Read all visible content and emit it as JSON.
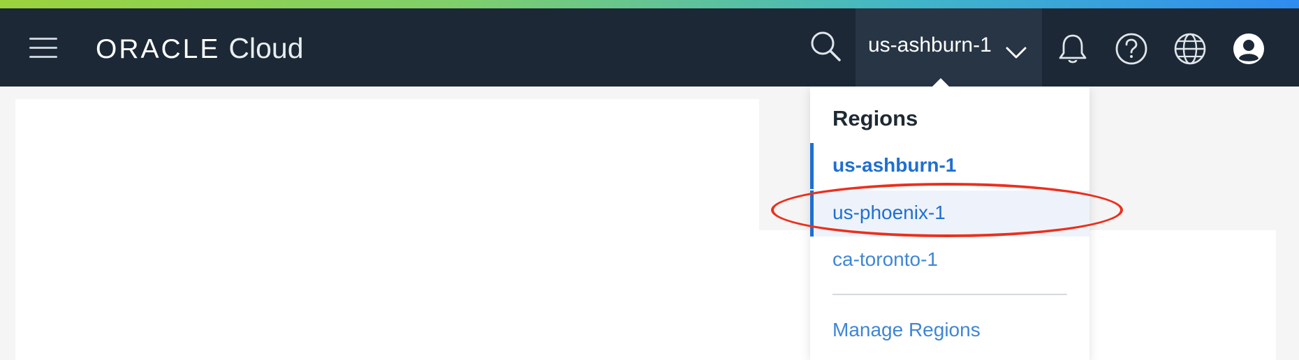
{
  "header": {
    "brand_oracle": "ORACLE",
    "brand_cloud": "Cloud",
    "region_selector": "us-ashburn-1",
    "icons": [
      "menu-icon",
      "search-icon",
      "chevron-down-icon",
      "bell-icon",
      "help-icon",
      "globe-icon",
      "user-icon"
    ]
  },
  "regions_menu": {
    "title": "Regions",
    "items": [
      {
        "label": "us-ashburn-1",
        "state": "selected"
      },
      {
        "label": "us-phoenix-1",
        "state": "hover"
      },
      {
        "label": "ca-toronto-1",
        "state": "normal"
      }
    ],
    "manage_link": "Manage Regions"
  },
  "colors": {
    "header_bg": "#1c2836",
    "region_button_bg": "#273545",
    "link_blue": "#1f6fd0",
    "annotation_red": "#ec2f1c"
  }
}
